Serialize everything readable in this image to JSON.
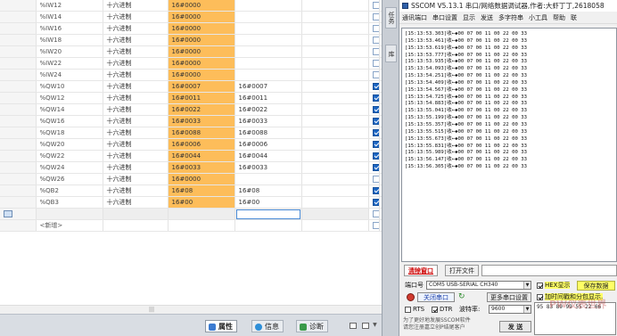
{
  "watch_table": {
    "rows": [
      {
        "addr": "%IW12",
        "fmt": "十六进制",
        "monitor": "16#0000",
        "modify": "",
        "checked": false,
        "warn": false
      },
      {
        "addr": "%IW14",
        "fmt": "十六进制",
        "monitor": "16#0000",
        "modify": "",
        "checked": false,
        "warn": false
      },
      {
        "addr": "%IW16",
        "fmt": "十六进制",
        "monitor": "16#0000",
        "modify": "",
        "checked": false,
        "warn": false
      },
      {
        "addr": "%IW18",
        "fmt": "十六进制",
        "monitor": "16#0000",
        "modify": "",
        "checked": false,
        "warn": false
      },
      {
        "addr": "%IW20",
        "fmt": "十六进制",
        "monitor": "16#0000",
        "modify": "",
        "checked": false,
        "warn": false
      },
      {
        "addr": "%IW22",
        "fmt": "十六进制",
        "monitor": "16#0000",
        "modify": "",
        "checked": false,
        "warn": false
      },
      {
        "addr": "%IW24",
        "fmt": "十六进制",
        "monitor": "16#0000",
        "modify": "",
        "checked": false,
        "warn": false
      },
      {
        "addr": "%QW10",
        "fmt": "十六进制",
        "monitor": "16#0007",
        "modify": "16#0007",
        "checked": true,
        "warn": true
      },
      {
        "addr": "%QW12",
        "fmt": "十六进制",
        "monitor": "16#0011",
        "modify": "16#0011",
        "checked": true,
        "warn": true
      },
      {
        "addr": "%QW14",
        "fmt": "十六进制",
        "monitor": "16#0022",
        "modify": "16#0022",
        "checked": true,
        "warn": true
      },
      {
        "addr": "%QW16",
        "fmt": "十六进制",
        "monitor": "16#0033",
        "modify": "16#0033",
        "checked": true,
        "warn": true
      },
      {
        "addr": "%QW18",
        "fmt": "十六进制",
        "monitor": "16#0088",
        "modify": "16#0088",
        "checked": true,
        "warn": true
      },
      {
        "addr": "%QW20",
        "fmt": "十六进制",
        "monitor": "16#0006",
        "modify": "16#0006",
        "checked": true,
        "warn": true
      },
      {
        "addr": "%QW22",
        "fmt": "十六进制",
        "monitor": "16#0044",
        "modify": "16#0044",
        "checked": true,
        "warn": true
      },
      {
        "addr": "%QW24",
        "fmt": "十六进制",
        "monitor": "16#0033",
        "modify": "16#0033",
        "checked": true,
        "warn": true
      },
      {
        "addr": "%QW26",
        "fmt": "十六进制",
        "monitor": "16#0000",
        "modify": "",
        "checked": false,
        "warn": false
      },
      {
        "addr": "%QB2",
        "fmt": "十六进制",
        "monitor": "16#08",
        "modify": "16#08",
        "checked": true,
        "warn": true
      },
      {
        "addr": "%QB3",
        "fmt": "十六进制",
        "monitor": "16#00",
        "modify": "16#00",
        "checked": true,
        "warn": true
      }
    ],
    "new_row_label": "<新增>"
  },
  "bottom_tabs": [
    {
      "label": "属性",
      "active": true,
      "icon_color": "#3b7bd1"
    },
    {
      "label": "信息",
      "active": false,
      "icon_color": "#2f8fd8"
    },
    {
      "label": "诊断",
      "active": false,
      "icon_color": "#3a9a4a"
    }
  ],
  "side_tabs": [
    "任务",
    "库"
  ],
  "sscom": {
    "title": "SSCOM V5.13.1 串口/网络数据调试器,作者:大虾丁丁,2618058",
    "menu": [
      "通讯端口",
      "串口设置",
      "显示",
      "发送",
      "多字符串",
      "小工具",
      "帮助",
      "联"
    ],
    "output_lines": [
      "[15:13:53.303]收←◆00 07 00 11 00 22 00 33",
      "[15:13:53.461]收←◆00 07 00 11 00 22 00 33",
      "[15:13:53.619]收←◆00 07 00 11 00 22 00 33",
      "[15:13:53.777]收←◆00 07 00 11 00 22 00 33",
      "[15:13:53.935]收←◆00 07 00 11 00 22 00 33",
      "[15:13:54.093]收←◆00 07 00 11 00 22 00 33",
      "[15:13:54.251]收←◆00 07 00 11 00 22 00 33",
      "[15:13:54.409]收←◆00 07 00 11 00 22 00 33",
      "[15:13:54.567]收←◆00 07 00 11 00 22 00 33",
      "[15:13:54.725]收←◆00 07 00 11 00 22 00 33",
      "[15:13:54.883]收←◆00 07 00 11 00 22 00 33",
      "[15:13:55.041]收←◆00 07 00 11 00 22 00 33",
      "[15:13:55.199]收←◆00 07 00 11 00 22 00 33",
      "[15:13:55.357]收←◆00 07 00 11 00 22 00 33",
      "[15:13:55.515]收←◆00 07 00 11 00 22 00 33",
      "[15:13:55.673]收←◆00 07 00 11 00 22 00 33",
      "[15:13:55.831]收←◆00 07 00 11 00 22 00 33",
      "[15:13:55.989]收←◆00 07 00 11 00 22 00 33",
      "[15:13:56.147]收←◆00 07 00 11 00 22 00 33",
      "[15:13:56.305]收←◆00 07 00 11 00 22 00 33"
    ],
    "tab_clear": "清除窗口",
    "tab_open": "打开文件",
    "port_label": "端口号",
    "port_value": "COM5 USB-SERIAL CH340",
    "hex_display": "HEX显示",
    "save_data": "保存数据",
    "close_port": "关闭串口",
    "more_settings": "更多串口设置",
    "timestamp_label": "加时间戳和分包显示.",
    "rts": "RTS",
    "dtr": "DTR",
    "baud_label": "波特率:",
    "baud_value": "9600",
    "send_text": "95 83 89 99 55 22 66",
    "send_button": "发 送",
    "footer": "为了更好地发展SSCOM软件\n请您注册嘉立创P结尾客户",
    "watermark": "PW仪表世界"
  }
}
